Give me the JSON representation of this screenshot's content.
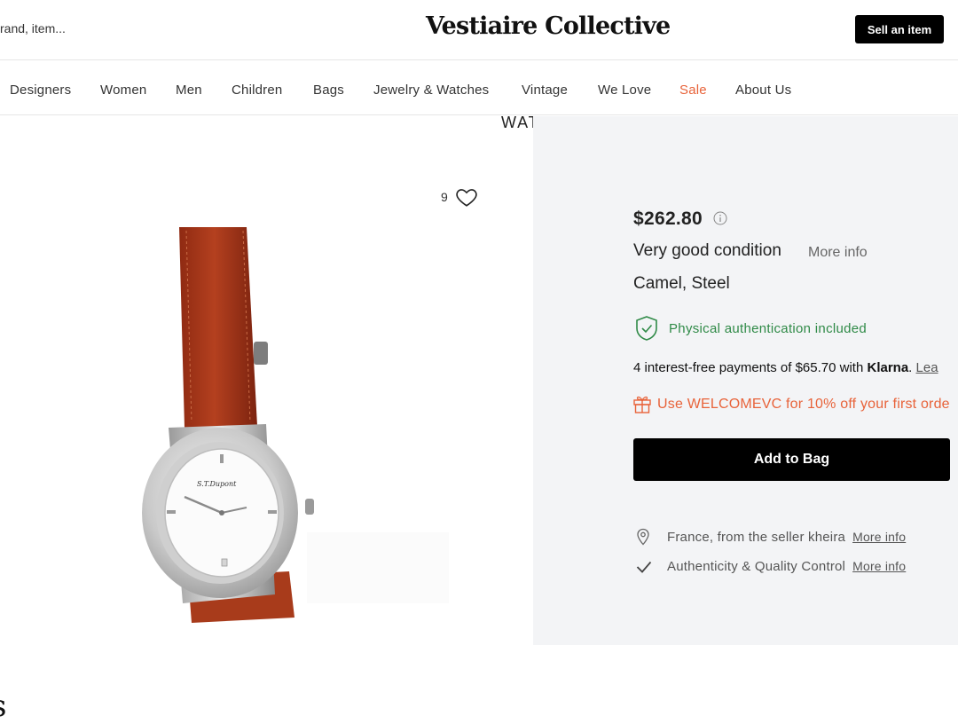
{
  "header": {
    "search_text": "rand, item...",
    "logo": "Vestiaire Collective",
    "sell_label": "Sell an item"
  },
  "nav": {
    "items": [
      {
        "label": "Designers"
      },
      {
        "label": "Women"
      },
      {
        "label": "Men"
      },
      {
        "label": "Children"
      },
      {
        "label": "Bags"
      },
      {
        "label": "Jewelry & Watches"
      },
      {
        "label": "Vintage"
      },
      {
        "label": "We Love"
      },
      {
        "label": "Sale"
      },
      {
        "label": "About Us"
      }
    ],
    "sale_color": "#e8633a"
  },
  "product": {
    "category": "WATCH",
    "like_count": "9",
    "watch_logo_text": "S.T.Dupont",
    "price": "$262.80",
    "condition": "Very good condition",
    "condition_more": "More info",
    "material": "Camel, Steel",
    "authentication": "Physical authentication included",
    "klarna": {
      "prefix": "4 interest-free payments of $65.70 with ",
      "brand": "Klarna",
      "suffix": ". ",
      "link": "Lea"
    },
    "promo": "Use WELCOMEVC for 10% off your first orde",
    "add_to_bag": "Add to Bag",
    "location_text": "France, from the seller kheira",
    "location_more": "More info",
    "quality_text": "Authenticity & Quality Control",
    "quality_more": "More info"
  },
  "colors": {
    "accent_orange": "#e8633a",
    "auth_green": "#2f8a47",
    "panel_bg": "#f3f4f6",
    "button_black": "#000000"
  },
  "footer_fragment": "s"
}
